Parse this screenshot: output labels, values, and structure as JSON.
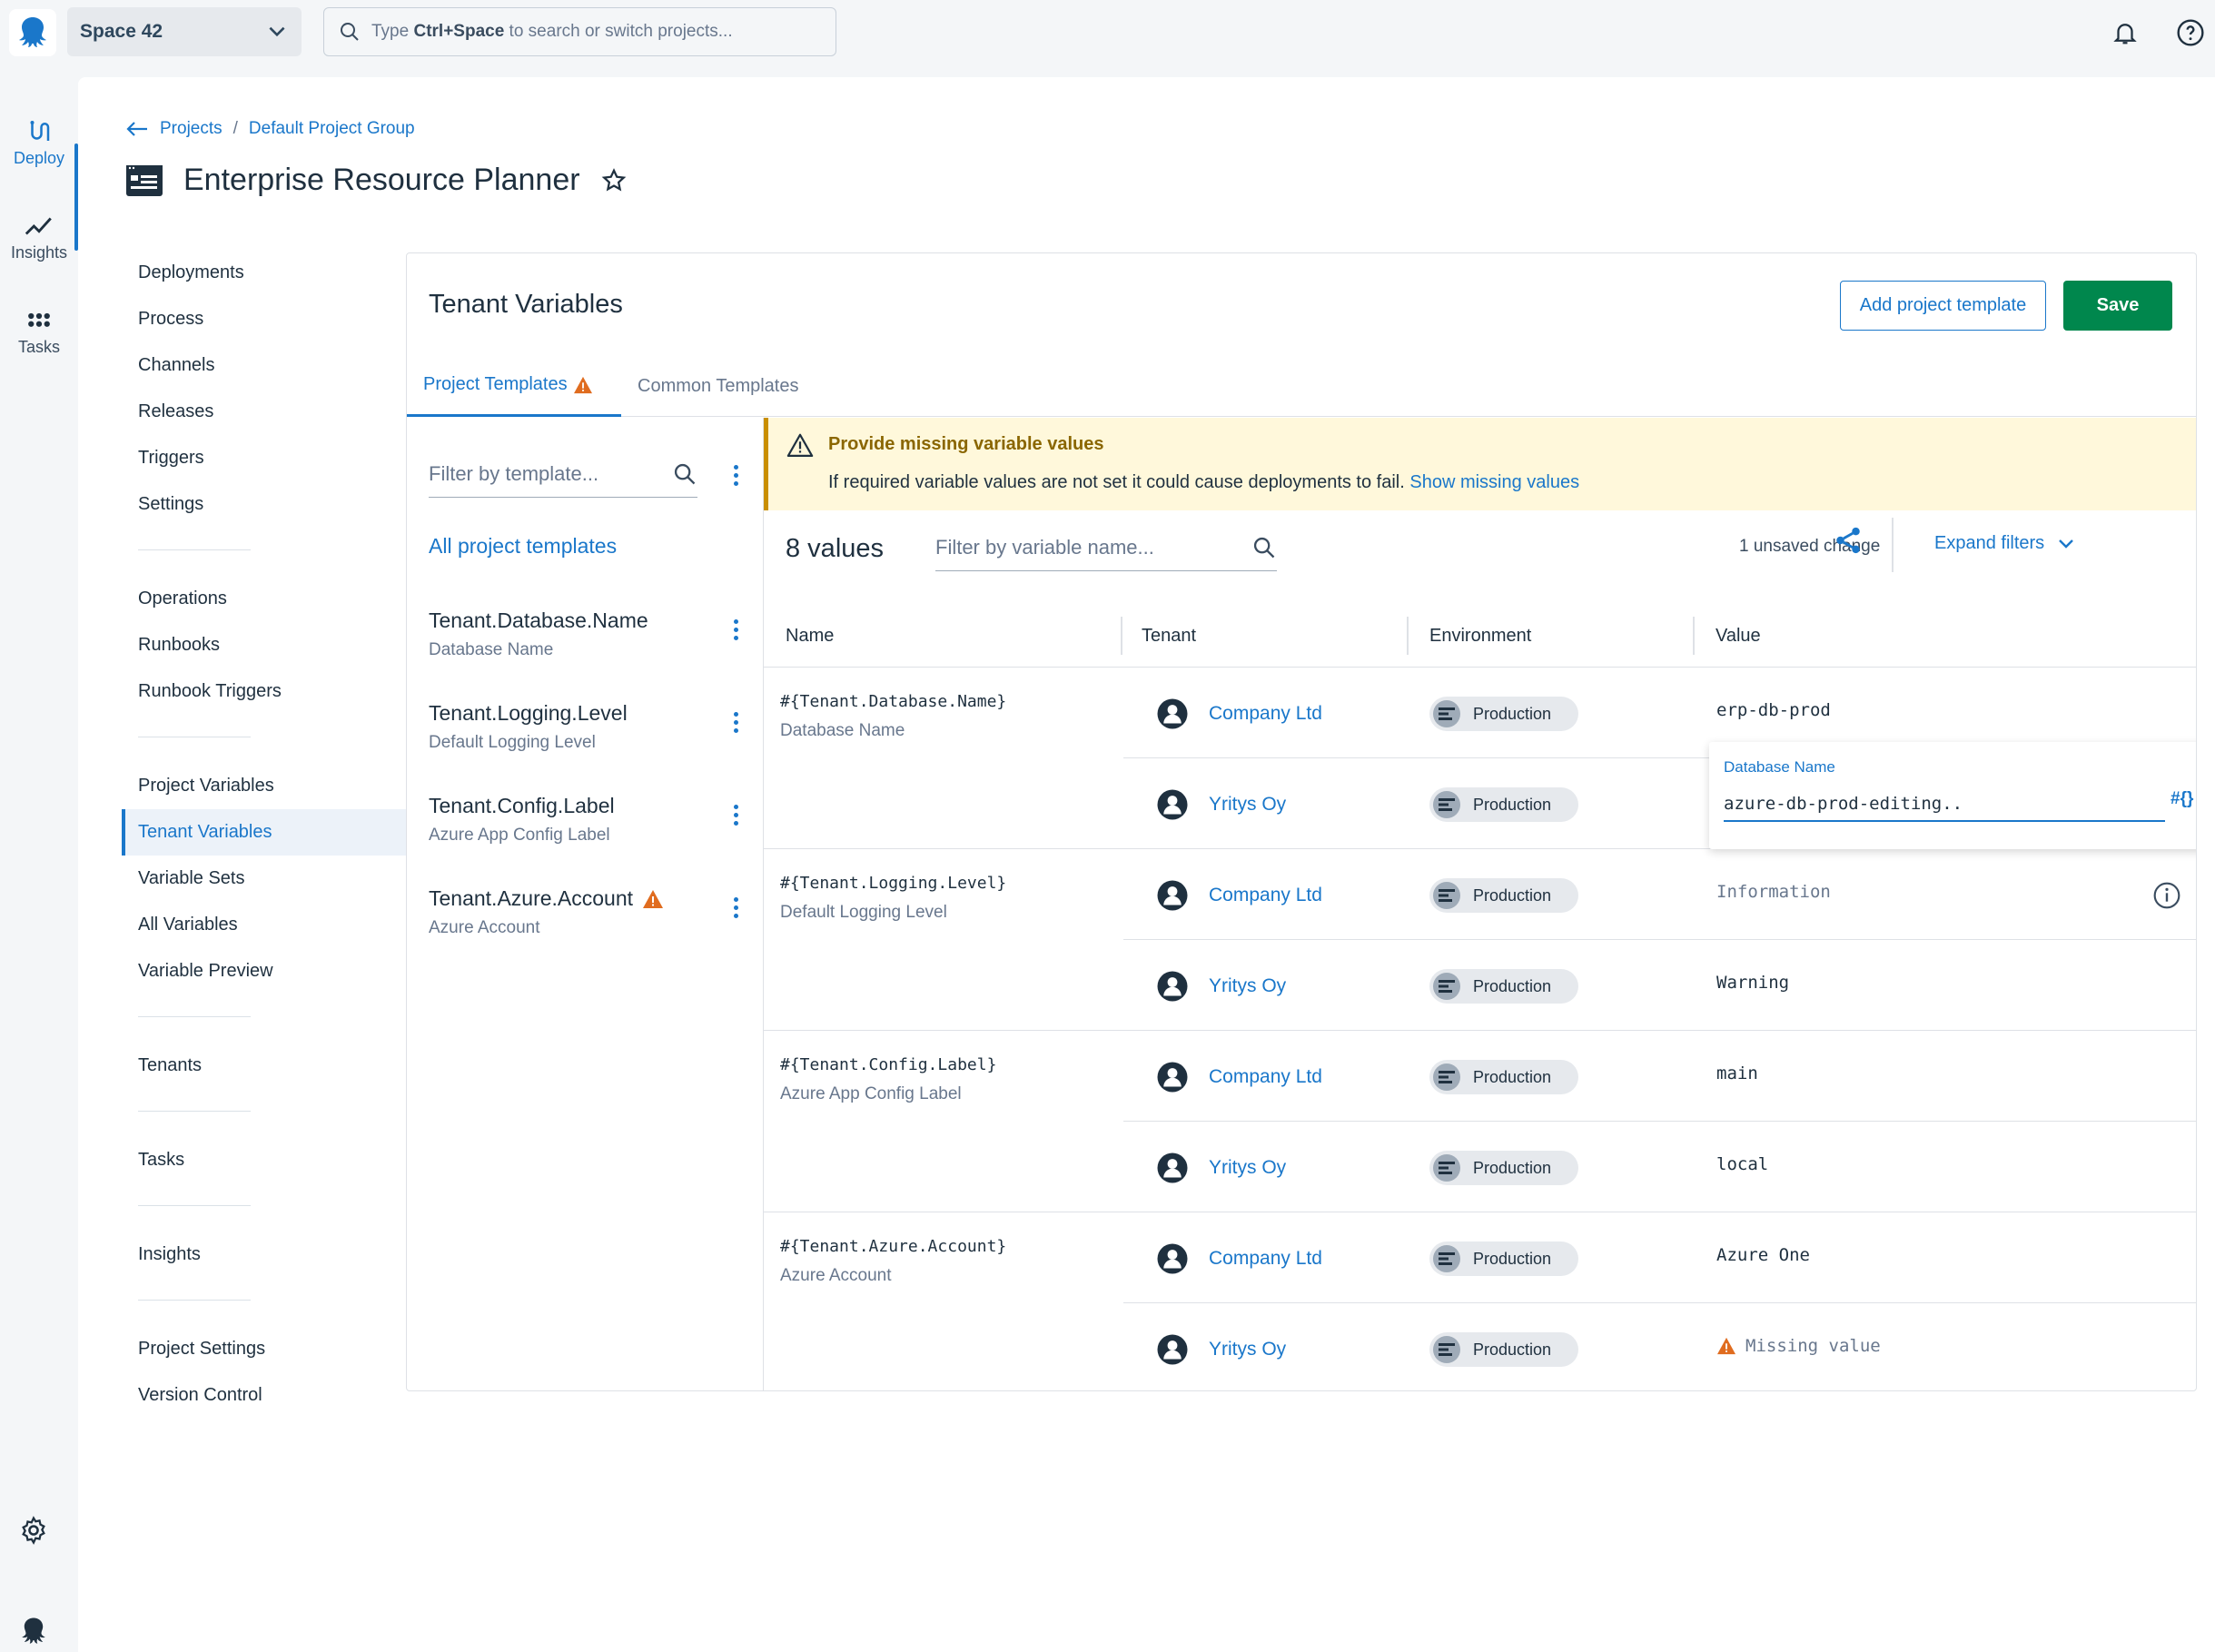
{
  "topbar": {
    "space": "Space 42",
    "search_prefix": "Type ",
    "search_key": "Ctrl+Space",
    "search_suffix": " to search or switch projects..."
  },
  "rail": [
    {
      "label": "Deploy",
      "icon": "deploy-icon"
    },
    {
      "label": "Insights",
      "icon": "insights-icon"
    },
    {
      "label": "Tasks",
      "icon": "tasks-icon"
    }
  ],
  "breadcrumb": {
    "projects": "Projects",
    "sep": "/",
    "group": "Default Project Group"
  },
  "page": {
    "title": "Enterprise Resource Planner"
  },
  "subnav": {
    "group1": [
      "Deployments",
      "Process",
      "Channels",
      "Releases",
      "Triggers",
      "Settings"
    ],
    "group2": [
      "Operations",
      "Runbooks",
      "Runbook Triggers"
    ],
    "group3": [
      "Project Variables",
      "Tenant Variables",
      "Variable Sets",
      "All Variables",
      "Variable Preview"
    ],
    "group4": [
      "Tenants"
    ],
    "group5": [
      "Tasks"
    ],
    "group6": [
      "Insights"
    ],
    "group7": [
      "Project Settings",
      "Version Control"
    ],
    "active": "Tenant Variables"
  },
  "card": {
    "title": "Tenant Variables",
    "add_button": "Add project template",
    "save_button": "Save",
    "tabs": {
      "active": "Project Templates",
      "inactive": "Common Templates"
    }
  },
  "templates": {
    "filter_placeholder": "Filter by template...",
    "all_label": "All project templates",
    "items": [
      {
        "name": "Tenant.Database.Name",
        "desc": "Database Name",
        "warning": false
      },
      {
        "name": "Tenant.Logging.Level",
        "desc": "Default Logging Level",
        "warning": false
      },
      {
        "name": "Tenant.Config.Label",
        "desc": "Azure App Config Label",
        "warning": false
      },
      {
        "name": "Tenant.Azure.Account",
        "desc": "Azure Account",
        "warning": true
      }
    ]
  },
  "alert": {
    "title": "Provide missing variable values",
    "body": "If required variable values are not set it could cause deployments to fail.",
    "link": "Show missing values"
  },
  "values": {
    "count": "8 values",
    "filter_placeholder": "Filter by variable name...",
    "unsaved": "1 unsaved change",
    "expand": "Expand filters",
    "columns": [
      "Name",
      "Tenant",
      "Environment",
      "Value"
    ]
  },
  "groups": [
    {
      "name": "#{Tenant.Database.Name}",
      "desc": "Database Name",
      "rows": [
        {
          "tenant": "Company Ltd",
          "env": "Production",
          "value": "erp-db-prod"
        },
        {
          "tenant": "Yritys Oy",
          "env": "Production",
          "value": ""
        }
      ]
    },
    {
      "name": "#{Tenant.Logging.Level}",
      "desc": "Default Logging Level",
      "rows": [
        {
          "tenant": "Company Ltd",
          "env": "Production",
          "value": "Information"
        },
        {
          "tenant": "Yritys Oy",
          "env": "Production",
          "value": "Warning"
        }
      ]
    },
    {
      "name": "#{Tenant.Config.Label}",
      "desc": "Azure App Config Label",
      "rows": [
        {
          "tenant": "Company Ltd",
          "env": "Production",
          "value": "main"
        },
        {
          "tenant": "Yritys Oy",
          "env": "Production",
          "value": "local"
        }
      ]
    },
    {
      "name": "#{Tenant.Azure.Account}",
      "desc": "Azure Account",
      "rows": [
        {
          "tenant": "Company Ltd",
          "env": "Production",
          "value": "Azure One"
        },
        {
          "tenant": "Yritys Oy",
          "env": "Production",
          "value": "Missing value"
        }
      ]
    }
  ],
  "editor": {
    "label": "Database Name",
    "value": "azure-db-prod-editing..",
    "hash": "#{}"
  },
  "colors": {
    "accent": "#1a77ca",
    "save": "#00874d",
    "warning": "#e06c1f",
    "alert_bg": "#fff8db"
  }
}
